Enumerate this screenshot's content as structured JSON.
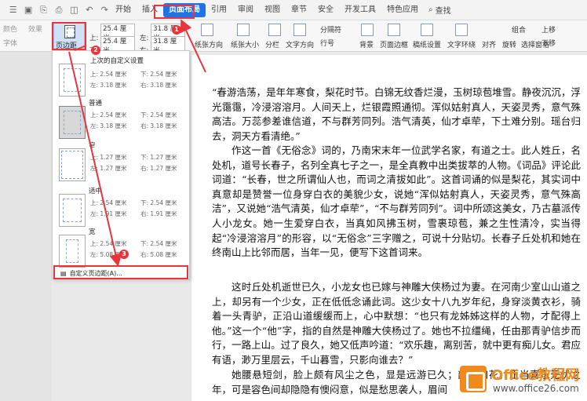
{
  "menubar": {
    "tabs": [
      "开始",
      "插入",
      "页面布局",
      "引用",
      "审阅",
      "视图",
      "章节",
      "安全",
      "开发工具",
      "特色应用"
    ],
    "active_tab": "页面布局",
    "search": "查找"
  },
  "ribbon": {
    "margin_button": "页边距",
    "top_margin": "25.4 厘米",
    "bottom_margin": "25.4 厘米",
    "left_margin": "31.8 厘米",
    "right_margin": "31.8 厘米",
    "top_label": "上:",
    "bottom_label": "下:",
    "left_label": "左:",
    "right_label": "右:",
    "paper_orientation": "纸张方向",
    "paper_size": "纸张大小",
    "columns": "分栏",
    "text_direction": "文字方向",
    "separator": "分隔符",
    "line_number": "行号",
    "background": "背景",
    "page_border": "页面边框",
    "draft_paper": "稿纸设置",
    "text_wrap": "文字环绕",
    "align": "对齐",
    "rotate": "旋转",
    "select_pane": "选择窗格",
    "group": "组合",
    "move_up": "上移",
    "move_down": "下移",
    "small_labels": [
      "颜色",
      "字体",
      "效果"
    ]
  },
  "dropdown": {
    "presets": [
      {
        "title": "上次的自定义设置",
        "top": "上: 2.54 厘米",
        "bottom": "下: 2.54 厘米",
        "left": "左: 3.18 厘米",
        "right": "右: 3.18 厘米"
      },
      {
        "title": "普通",
        "top": "上: 2.54 厘米",
        "bottom": "下: 2.54 厘米",
        "left": "左: 3.18 厘米",
        "right": "右: 3.18 厘米"
      },
      {
        "title": "窄",
        "top": "上: 1.27 厘米",
        "bottom": "下: 1.27 厘米",
        "left": "左: 1.27 厘米",
        "right": "右: 1.27 厘米"
      },
      {
        "title": "适中",
        "top": "上: 2.54 厘米",
        "bottom": "下: 2.54 厘米",
        "left": "左: 1.91 厘米",
        "right": "右: 1.91 厘米"
      },
      {
        "title": "宽",
        "top": "上: 2.54 厘米",
        "bottom": "下: 2.54 厘米",
        "left": "左: 5.08 厘米",
        "right": "右: 5.08 厘米"
      }
    ],
    "custom": "自定义页边距(A)..."
  },
  "annotations": [
    "1",
    "2",
    "3"
  ],
  "document": {
    "paragraphs": [
      "“春游浩荡，是年年寒食，梨花时节。白锦无纹香烂漫，玉树琼苞堆雪。静夜沉沉，浮光霭霭，冷浸溶溶月。人间天上，烂银霞照通彻。浑似姑射真人，天姿灵秀，意气殊高洁。万蕊参差谁信道，不与群芳同列。浩气清英，仙才卓荦，下土难分别。瑶台归去，洞天方看清绝。”",
      "作这一首《无俗念》词的，乃南宋末年一位武学名家，有道之士。此人姓丘，名处机，道号长春子，名列全真七子之一，是全真教中出类拔萃的人物。《词品》评论此词道：“长春，世之所谓仙人也，而词之清拔如此”。这首词诵的似是梨花，其实词中真意却是赞誉一位身穿白衣的美貌少女，说她“浑似姑射真人，天姿灵秀，意气殊高洁”，又说她“浩气清英，仙才卓荦”，“不与群芳同列”。词中所颂这美女，乃古墓派传人小龙女。她一生爱穿白衣，当真如风拂玉树，雪裹琼苞，兼之生性清冷，实当得起“冷浸溶溶月”的形容，以“无俗念”三字赠之，可说十分贴切。长春子丘处机和她在终南山上比邻而居，当年一见，便写下这首词来。",
      "这时丘处机逝世已久，小龙女也已嫁与神雕大侠杨过为妻。在河南少室山山道之上，却另有一个少女，正在低低念诵此词。这少女十八九岁年纪，身穿淡黄衣衫，骑着一头青驴，正沿山道缓缓而上，心中默想：“也只有龙姊姊这样的人物，才配得上他。”这一个“他”字，指的自然是神雕大侠杨过了。她也不拉缰绳，任由那青驴信步而行，一路上山。过了良久，她又低声吟道：“欢乐趣，离别苦，就中更有痴儿女。君应有语，渺万里层云，千山暮雪，只影向谁去？”",
      "她腰悬短剑，脸上颇有风尘之色，显是远游已久；韶华如花，正当喜乐无忧之年，可是容色间却隐隐有懊闷意，似是愁思袭人，眉间"
    ]
  },
  "logo": {
    "line1": "Office教程网",
    "line2": "www.office26.com"
  }
}
